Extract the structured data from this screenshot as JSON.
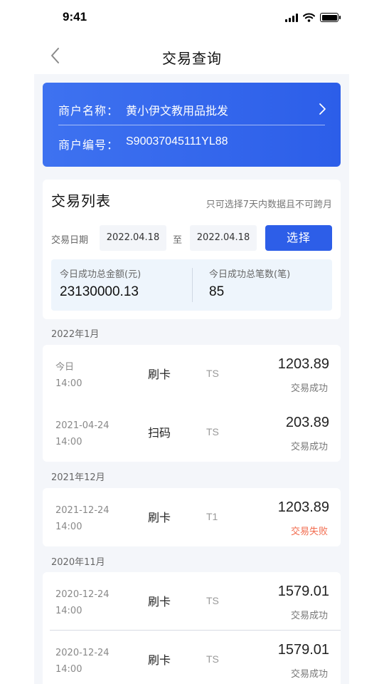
{
  "status_bar": {
    "time": "9:41"
  },
  "nav": {
    "title": "交易查询"
  },
  "merchant": {
    "name_label": "商户名称：",
    "name_value": "黄小伊文教用品批发",
    "id_label": "商户编号：",
    "id_value": "S90037045111YL88"
  },
  "list": {
    "title": "交易列表",
    "hint": "只可选择7天内数据且不可跨月",
    "date_label": "交易日期",
    "date_from": "2022.04.18",
    "date_sep": "至",
    "date_to": "2022.04.18",
    "select_label": "选择",
    "stats": {
      "total_amount_label": "今日成功总金额(元)",
      "total_amount_value": "23130000.13",
      "total_count_label": "今日成功总笔数(笔)",
      "total_count_value": "85"
    }
  },
  "groups": [
    {
      "label": "2022年1月",
      "transactions": [
        {
          "date": "今日",
          "time": "14:00",
          "type": "刷卡",
          "settle": "TS",
          "amount": "1203.89",
          "status": "交易成功"
        },
        {
          "date": "2021-04-24",
          "time": "14:00",
          "type": "扫码",
          "settle": "TS",
          "amount": "203.89",
          "status": "交易成功"
        }
      ]
    },
    {
      "label": "2021年12月",
      "transactions": [
        {
          "date": "2021-12-24",
          "time": "14:00",
          "type": "刷卡",
          "settle": "T1",
          "amount": "1203.89",
          "status": "交易失败"
        }
      ]
    },
    {
      "label": "2020年11月",
      "transactions": [
        {
          "date": "2020-12-24",
          "time": "14:00",
          "type": "刷卡",
          "settle": "TS",
          "amount": "1579.01",
          "status": "交易成功"
        },
        {
          "date": "2020-12-24",
          "time": "14:00",
          "type": "刷卡",
          "settle": "TS",
          "amount": "1579.01",
          "status": "交易成功"
        }
      ]
    }
  ],
  "colors": {
    "accent": "#2d5ee8",
    "fail": "#f26b4e",
    "page_bg": "#f4f6fa"
  },
  "icons": {
    "back": "chevron-left-icon",
    "merchant_detail": "chevron-right-icon"
  }
}
